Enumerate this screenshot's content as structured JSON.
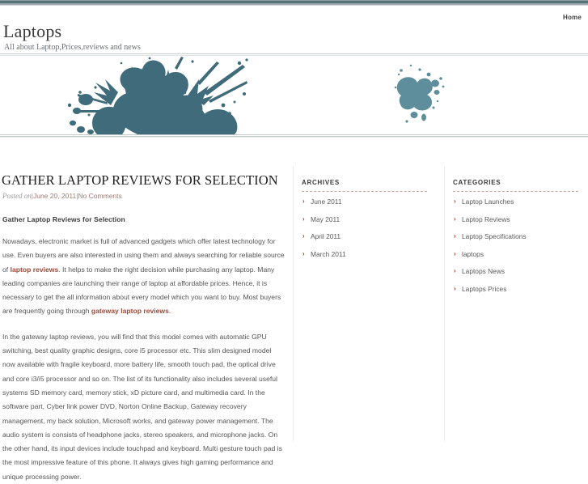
{
  "topbar": {
    "accent_color": "#55717a"
  },
  "nav": {
    "items": [
      {
        "label": "Home",
        "name": "nav-item-home"
      }
    ]
  },
  "branding": {
    "site_title": "Laptops",
    "site_description": "All about Laptop,Prices,reviews and news"
  },
  "banner": {
    "alt": "teal ink splatter banner",
    "splatter_color": "#3f6b7a",
    "splatter_color_light": "#5e8e9c"
  },
  "post": {
    "title": "Gather Laptop Reviews for Selection",
    "meta_prefix": "Posted on",
    "meta_separator": "|",
    "date": "June 20, 2011",
    "comments": "No Comments",
    "subheading": "Gather Laptop Reviews for Selection",
    "paragraph_1": {
      "part_1": "Nowadays, electronic market is full of advanced gadgets which offer latest technology for use. Even buyers are also interested in using them and always searching for reliable source of ",
      "link_1": "laptop reviews",
      "part_2": ". It helps to make the right decision while purchasing any laptop. Many leading companies are launching their range of laptop at affordable prices. Hence, it is necessary to get the all information about every model which you want to buy. Most buyers are frequently going through ",
      "link_2": "gateway laptop reviews",
      "part_3": "."
    },
    "paragraph_2": "In the gateway laptop reviews, you will find that this model comes with automatic GPU switching, best quality graphic designs, core i5 processor etc. This slim designed model now available with fragile keyboard, more battery life, smooth touch pad, the optical drive and core i3/i5 processor and so on. The list of its functionality also includes several useful systems SD memory card, memory stick, xD picture card, and multimedia card. In the software part, Cyber link power DVD, Norton Online Backup, Gateway recovery management, my back solution, Microsoft works, and gateway power management. The audio system is consists of headphone jacks, stereo speakers, and microphone jacks. On the other hand, its input devices include touchpad and keyboard. Multi gesture touch pad is the most impressive feature of this phone. It always gives high gaming performance and unique processing power."
  },
  "sidebar": {
    "archives": {
      "title": "Archives",
      "items": [
        {
          "label": "June 2011"
        },
        {
          "label": "May 2011"
        },
        {
          "label": "April 2011"
        },
        {
          "label": "March 2011"
        }
      ]
    },
    "categories": {
      "title": "Categories",
      "items": [
        {
          "label": "Laptop Launches"
        },
        {
          "label": "Laptop Reviews"
        },
        {
          "label": "Laptop Specifications"
        },
        {
          "label": "laptops"
        },
        {
          "label": "Laptops News"
        },
        {
          "label": "Laptops Prices"
        }
      ]
    },
    "bullet_glyph": "›",
    "bullet_color": "#a83a2c"
  }
}
